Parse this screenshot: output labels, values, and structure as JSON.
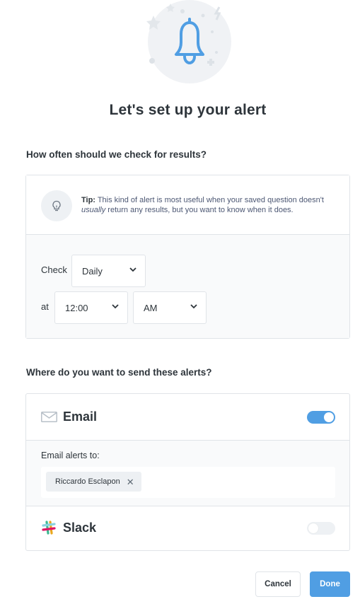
{
  "dialog": {
    "title": "Let's set up your alert"
  },
  "frequency": {
    "heading": "How often should we check for results?",
    "tip": {
      "label": "Tip:",
      "text_part1": " This kind of alert is most useful when your saved question doesn't ",
      "text_emphasis": "usually",
      "text_part2": " return any results, but you want to know when it does."
    },
    "check_label": "Check",
    "check_value": "Daily",
    "at_label": "at",
    "time_value": "12:00",
    "ampm_value": "AM"
  },
  "channels": {
    "heading": "Where do you want to send these alerts?",
    "email": {
      "name": "Email",
      "enabled": true,
      "recipients_label": "Email alerts to:",
      "recipients": [
        "Riccardo Esclapon"
      ],
      "remove_glyph": "✕"
    },
    "slack": {
      "name": "Slack",
      "enabled": false
    }
  },
  "footer": {
    "cancel_label": "Cancel",
    "done_label": "Done"
  },
  "colors": {
    "accent": "#509ee3",
    "text": "#2e353b",
    "border": "#e0e4e8",
    "toggle_off": "#eef1f4"
  }
}
